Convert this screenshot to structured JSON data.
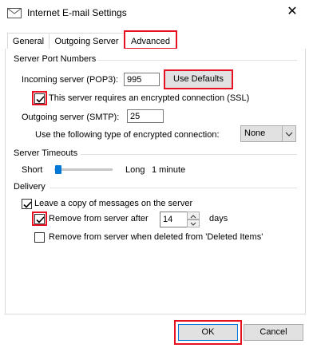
{
  "window": {
    "title": "Internet E-mail Settings",
    "close_glyph": "✕"
  },
  "tabs": [
    {
      "label": "General"
    },
    {
      "label": "Outgoing Server"
    },
    {
      "label": "Advanced"
    }
  ],
  "server_ports": {
    "section_title": "Server Port Numbers",
    "incoming_label": "Incoming server (POP3):",
    "incoming_value": "995",
    "use_defaults_label": "Use Defaults",
    "ssl_label": "This server requires an encrypted connection (SSL)",
    "ssl_checked": true,
    "outgoing_label": "Outgoing server (SMTP):",
    "outgoing_value": "25",
    "encryption_label": "Use the following type of encrypted connection:",
    "encryption_value": "None"
  },
  "timeouts": {
    "section_title": "Server Timeouts",
    "short_label": "Short",
    "long_label": "Long",
    "value_text": "1 minute"
  },
  "delivery": {
    "section_title": "Delivery",
    "leave_copy_label": "Leave a copy of messages on the server",
    "leave_copy_checked": true,
    "remove_after_label": "Remove from server after",
    "remove_after_checked": true,
    "remove_after_days": "14",
    "days_label": "days",
    "remove_deleted_label": "Remove from server when deleted from 'Deleted Items'",
    "remove_deleted_checked": false
  },
  "footer": {
    "ok_label": "OK",
    "cancel_label": "Cancel"
  },
  "colors": {
    "highlight": "#e81123",
    "accent": "#0078d7"
  }
}
